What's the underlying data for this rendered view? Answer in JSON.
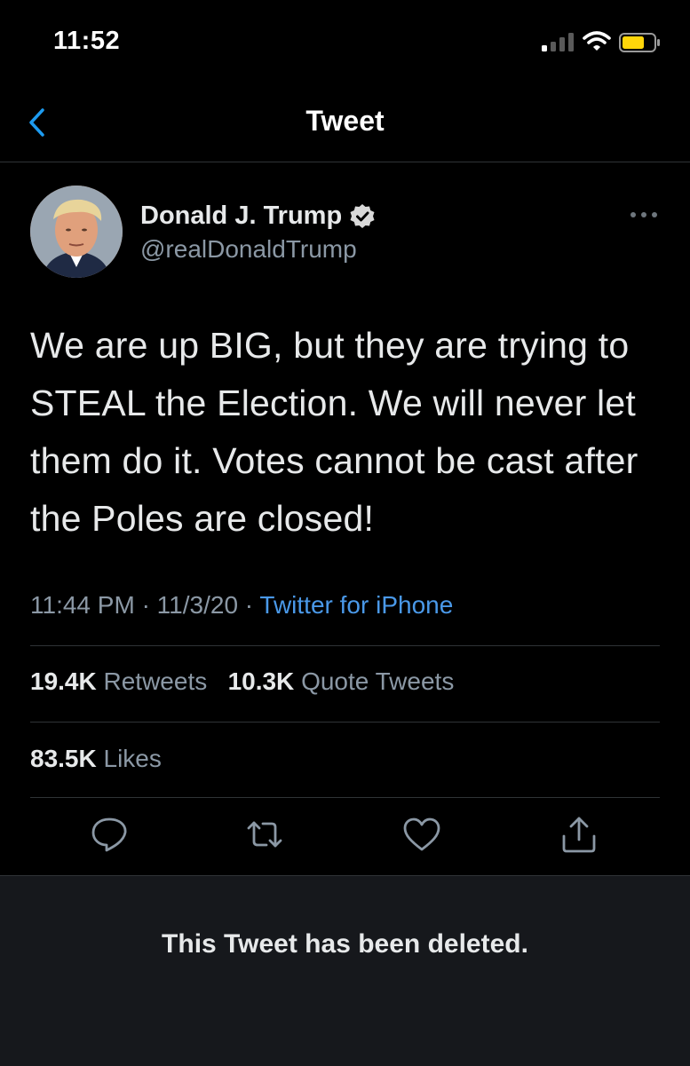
{
  "status_bar": {
    "time": "11:52"
  },
  "nav": {
    "title": "Tweet"
  },
  "author": {
    "display_name": "Donald J. Trump",
    "handle": "@realDonaldTrump",
    "verified": true
  },
  "tweet": {
    "text": "We are up BIG, but they are trying to STEAL the Election. We will never let them do it. Votes cannot be cast after the Poles are closed!",
    "time": "11:44 PM",
    "date": "11/3/20",
    "separator": "·",
    "source": "Twitter for iPhone"
  },
  "stats": {
    "retweets_count": "19.4K",
    "retweets_label": "Retweets",
    "quotes_count": "10.3K",
    "quotes_label": "Quote Tweets",
    "likes_count": "83.5K",
    "likes_label": "Likes"
  },
  "actions": [
    "reply-icon",
    "retweet-icon",
    "like-icon",
    "share-icon"
  ],
  "banner": {
    "text": "This Tweet has been deleted."
  },
  "colors": {
    "link": "#4a99e9",
    "secondary": "#8b98a5",
    "divider": "#2f3336",
    "banner_bg": "#16181c"
  }
}
